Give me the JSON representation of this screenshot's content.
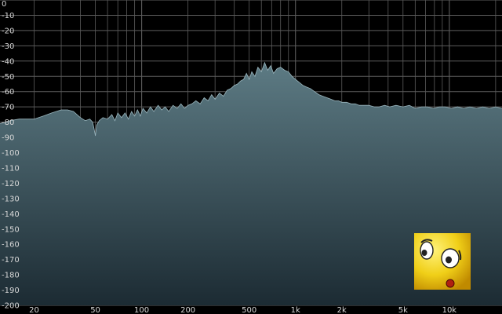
{
  "chart_data": {
    "type": "area",
    "xscale": "log",
    "xlim": [
      12,
      22000
    ],
    "ylim": [
      -200,
      0
    ],
    "grid": true,
    "xticks": [
      20,
      50,
      100,
      200,
      500,
      1000,
      2000,
      5000,
      10000
    ],
    "xtick_labels": [
      "20",
      "50",
      "100",
      "200",
      "500",
      "1k",
      "2k",
      "5k",
      "10k"
    ],
    "yticks": [
      0,
      -10,
      -20,
      -30,
      -40,
      -50,
      -60,
      -70,
      -80,
      -90,
      -100,
      -110,
      -120,
      -130,
      -140,
      -150,
      -160,
      -170,
      -180,
      -190,
      -200
    ],
    "ytick_labels": [
      "0",
      "-10",
      "-20",
      "-30",
      "-40",
      "-50",
      "-60",
      "-70",
      "-80",
      "-90",
      "-100",
      "-110",
      "-120",
      "-130",
      "-140",
      "-150",
      "-160",
      "-170",
      "-180",
      "-190",
      "-200"
    ],
    "series": [
      {
        "x": [
          12,
          14,
          16,
          18,
          20,
          23,
          26,
          30,
          33,
          36,
          40,
          43,
          46,
          48,
          49,
          50,
          51,
          53,
          56,
          60,
          64,
          67,
          70,
          74,
          78,
          82,
          86,
          90,
          94,
          98,
          102,
          108,
          114,
          120,
          128,
          135,
          142,
          150,
          160,
          170,
          180,
          190,
          200,
          212,
          225,
          240,
          255,
          270,
          285,
          300,
          320,
          340,
          360,
          380,
          400,
          420,
          440,
          460,
          480,
          500,
          520,
          545,
          570,
          600,
          630,
          660,
          690,
          720,
          760,
          800,
          850,
          900,
          950,
          1000,
          1060,
          1120,
          1180,
          1250,
          1330,
          1420,
          1500,
          1600,
          1700,
          1800,
          1900,
          2000,
          2150,
          2300,
          2450,
          2600,
          2800,
          3000,
          3250,
          3500,
          3800,
          4100,
          4500,
          5000,
          5500,
          6000,
          6600,
          7200,
          7900,
          8600,
          9400,
          10300,
          11300,
          12400,
          13600,
          15000,
          16500,
          18200,
          20000,
          22000
        ],
        "values": [
          -81,
          -79,
          -78,
          -78,
          -78,
          -76,
          -74,
          -72,
          -72,
          -73,
          -77,
          -79,
          -78,
          -80,
          -84,
          -89,
          -82,
          -79,
          -77,
          -78,
          -75,
          -79,
          -74,
          -77,
          -74,
          -78,
          -73,
          -76,
          -72,
          -76,
          -71,
          -74,
          -70,
          -73,
          -69,
          -72,
          -70,
          -73,
          -69,
          -71,
          -68,
          -71,
          -69,
          -68,
          -66,
          -68,
          -64,
          -66,
          -62,
          -65,
          -61,
          -63,
          -59,
          -58,
          -56,
          -55,
          -53,
          -52,
          -48,
          -52,
          -47,
          -50,
          -44,
          -47,
          -41,
          -46,
          -43,
          -48,
          -45,
          -44,
          -46,
          -47,
          -50,
          -52,
          -54,
          -56,
          -57,
          -58,
          -60,
          -62,
          -63,
          -64,
          -65,
          -66,
          -66,
          -67,
          -67,
          -68,
          -68,
          -69,
          -69,
          -69,
          -70,
          -70,
          -69,
          -70,
          -69,
          -70,
          -69,
          -71,
          -70,
          -70,
          -71,
          -70,
          -70,
          -71,
          -70,
          -71,
          -70,
          -71,
          -70,
          -71,
          -70,
          -71
        ]
      }
    ]
  },
  "overlay": {
    "icon": "surprised-face-icon",
    "colors": {
      "face": "#f0cf18",
      "eye": "#ffffff",
      "mouth": "#b02010"
    }
  },
  "colors": {
    "background": "#000000",
    "grid": "#5c5c5c",
    "fill_top": "#5d7b84",
    "fill_bottom": "#1c2b33",
    "outline": "#9ab6be",
    "label": "#d8d8d8"
  }
}
